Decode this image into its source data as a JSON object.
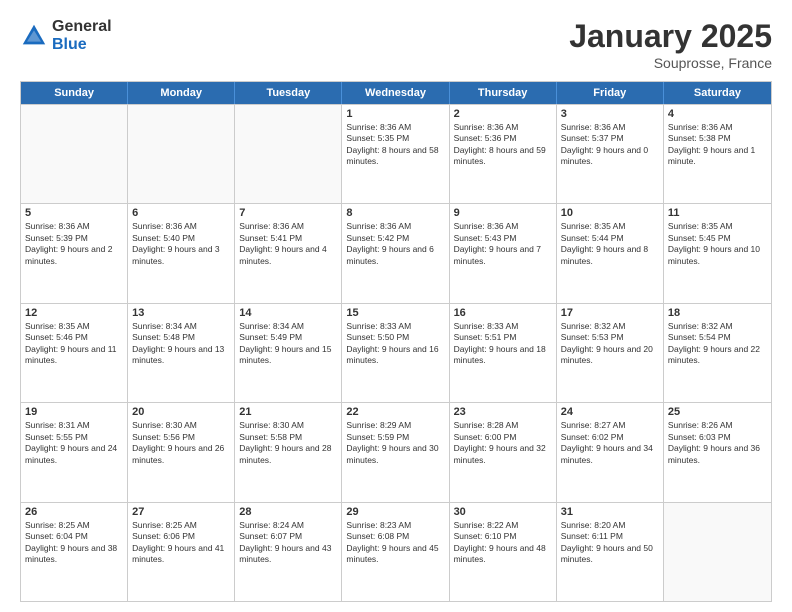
{
  "header": {
    "logo_general": "General",
    "logo_blue": "Blue",
    "month_title": "January 2025",
    "location": "Souprosse, France"
  },
  "days_of_week": [
    "Sunday",
    "Monday",
    "Tuesday",
    "Wednesday",
    "Thursday",
    "Friday",
    "Saturday"
  ],
  "weeks": [
    [
      {
        "day": "",
        "empty": true
      },
      {
        "day": "",
        "empty": true
      },
      {
        "day": "",
        "empty": true
      },
      {
        "day": "1",
        "sunrise": "8:36 AM",
        "sunset": "5:35 PM",
        "daylight": "8 hours and 58 minutes."
      },
      {
        "day": "2",
        "sunrise": "8:36 AM",
        "sunset": "5:36 PM",
        "daylight": "8 hours and 59 minutes."
      },
      {
        "day": "3",
        "sunrise": "8:36 AM",
        "sunset": "5:37 PM",
        "daylight": "9 hours and 0 minutes."
      },
      {
        "day": "4",
        "sunrise": "8:36 AM",
        "sunset": "5:38 PM",
        "daylight": "9 hours and 1 minute."
      }
    ],
    [
      {
        "day": "5",
        "sunrise": "8:36 AM",
        "sunset": "5:39 PM",
        "daylight": "9 hours and 2 minutes."
      },
      {
        "day": "6",
        "sunrise": "8:36 AM",
        "sunset": "5:40 PM",
        "daylight": "9 hours and 3 minutes."
      },
      {
        "day": "7",
        "sunrise": "8:36 AM",
        "sunset": "5:41 PM",
        "daylight": "9 hours and 4 minutes."
      },
      {
        "day": "8",
        "sunrise": "8:36 AM",
        "sunset": "5:42 PM",
        "daylight": "9 hours and 6 minutes."
      },
      {
        "day": "9",
        "sunrise": "8:36 AM",
        "sunset": "5:43 PM",
        "daylight": "9 hours and 7 minutes."
      },
      {
        "day": "10",
        "sunrise": "8:35 AM",
        "sunset": "5:44 PM",
        "daylight": "9 hours and 8 minutes."
      },
      {
        "day": "11",
        "sunrise": "8:35 AM",
        "sunset": "5:45 PM",
        "daylight": "9 hours and 10 minutes."
      }
    ],
    [
      {
        "day": "12",
        "sunrise": "8:35 AM",
        "sunset": "5:46 PM",
        "daylight": "9 hours and 11 minutes."
      },
      {
        "day": "13",
        "sunrise": "8:34 AM",
        "sunset": "5:48 PM",
        "daylight": "9 hours and 13 minutes."
      },
      {
        "day": "14",
        "sunrise": "8:34 AM",
        "sunset": "5:49 PM",
        "daylight": "9 hours and 15 minutes."
      },
      {
        "day": "15",
        "sunrise": "8:33 AM",
        "sunset": "5:50 PM",
        "daylight": "9 hours and 16 minutes."
      },
      {
        "day": "16",
        "sunrise": "8:33 AM",
        "sunset": "5:51 PM",
        "daylight": "9 hours and 18 minutes."
      },
      {
        "day": "17",
        "sunrise": "8:32 AM",
        "sunset": "5:53 PM",
        "daylight": "9 hours and 20 minutes."
      },
      {
        "day": "18",
        "sunrise": "8:32 AM",
        "sunset": "5:54 PM",
        "daylight": "9 hours and 22 minutes."
      }
    ],
    [
      {
        "day": "19",
        "sunrise": "8:31 AM",
        "sunset": "5:55 PM",
        "daylight": "9 hours and 24 minutes."
      },
      {
        "day": "20",
        "sunrise": "8:30 AM",
        "sunset": "5:56 PM",
        "daylight": "9 hours and 26 minutes."
      },
      {
        "day": "21",
        "sunrise": "8:30 AM",
        "sunset": "5:58 PM",
        "daylight": "9 hours and 28 minutes."
      },
      {
        "day": "22",
        "sunrise": "8:29 AM",
        "sunset": "5:59 PM",
        "daylight": "9 hours and 30 minutes."
      },
      {
        "day": "23",
        "sunrise": "8:28 AM",
        "sunset": "6:00 PM",
        "daylight": "9 hours and 32 minutes."
      },
      {
        "day": "24",
        "sunrise": "8:27 AM",
        "sunset": "6:02 PM",
        "daylight": "9 hours and 34 minutes."
      },
      {
        "day": "25",
        "sunrise": "8:26 AM",
        "sunset": "6:03 PM",
        "daylight": "9 hours and 36 minutes."
      }
    ],
    [
      {
        "day": "26",
        "sunrise": "8:25 AM",
        "sunset": "6:04 PM",
        "daylight": "9 hours and 38 minutes."
      },
      {
        "day": "27",
        "sunrise": "8:25 AM",
        "sunset": "6:06 PM",
        "daylight": "9 hours and 41 minutes."
      },
      {
        "day": "28",
        "sunrise": "8:24 AM",
        "sunset": "6:07 PM",
        "daylight": "9 hours and 43 minutes."
      },
      {
        "day": "29",
        "sunrise": "8:23 AM",
        "sunset": "6:08 PM",
        "daylight": "9 hours and 45 minutes."
      },
      {
        "day": "30",
        "sunrise": "8:22 AM",
        "sunset": "6:10 PM",
        "daylight": "9 hours and 48 minutes."
      },
      {
        "day": "31",
        "sunrise": "8:20 AM",
        "sunset": "6:11 PM",
        "daylight": "9 hours and 50 minutes."
      },
      {
        "day": "",
        "empty": true
      }
    ]
  ]
}
